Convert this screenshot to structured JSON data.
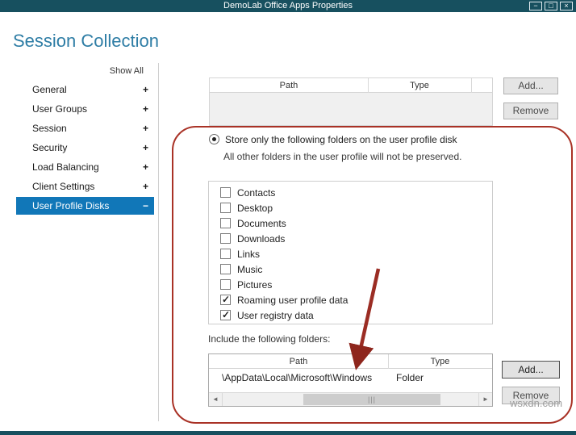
{
  "window": {
    "title": "DemoLab Office Apps Properties",
    "controls": {
      "minimize": "−",
      "maximize": "□",
      "close": "×"
    }
  },
  "page": {
    "title": "Session Collection"
  },
  "sidebar": {
    "show_all": "Show All",
    "items": [
      {
        "label": "General",
        "expander": "+",
        "selected": false
      },
      {
        "label": "User Groups",
        "expander": "+",
        "selected": false
      },
      {
        "label": "Session",
        "expander": "+",
        "selected": false
      },
      {
        "label": "Security",
        "expander": "+",
        "selected": false
      },
      {
        "label": "Load Balancing",
        "expander": "+",
        "selected": false
      },
      {
        "label": "Client Settings",
        "expander": "+",
        "selected": false
      },
      {
        "label": "User Profile Disks",
        "expander": "−",
        "selected": true
      }
    ]
  },
  "top_table": {
    "columns": [
      "Path",
      "Type"
    ],
    "rows": []
  },
  "buttons": {
    "add": "Add...",
    "remove": "Remove"
  },
  "store_option": {
    "radio_label": "Store only the following folders on the user profile disk",
    "radio_selected": true,
    "note": "All other folders in the user profile will not be preserved.",
    "folders": [
      {
        "label": "Contacts",
        "checked": false
      },
      {
        "label": "Desktop",
        "checked": false
      },
      {
        "label": "Documents",
        "checked": false
      },
      {
        "label": "Downloads",
        "checked": false
      },
      {
        "label": "Links",
        "checked": false
      },
      {
        "label": "Music",
        "checked": false
      },
      {
        "label": "Pictures",
        "checked": false
      },
      {
        "label": "Roaming user profile data",
        "checked": true
      },
      {
        "label": "User registry data",
        "checked": true
      }
    ],
    "include_label": "Include the following folders:",
    "include_table": {
      "columns": [
        "Path",
        "Type"
      ],
      "rows": [
        {
          "path": "\\AppData\\Local\\Microsoft\\Windows",
          "type": "Folder"
        }
      ]
    }
  },
  "icons": {
    "checkmark": "✓",
    "scroll_left": "◄",
    "scroll_right": "►",
    "thumb_grip": "|||"
  },
  "watermark": "wsxdn.com",
  "colors": {
    "titlebar": "#17505f",
    "heading": "#2e7da5",
    "selected": "#1177b8",
    "annotation": "#a93226"
  }
}
